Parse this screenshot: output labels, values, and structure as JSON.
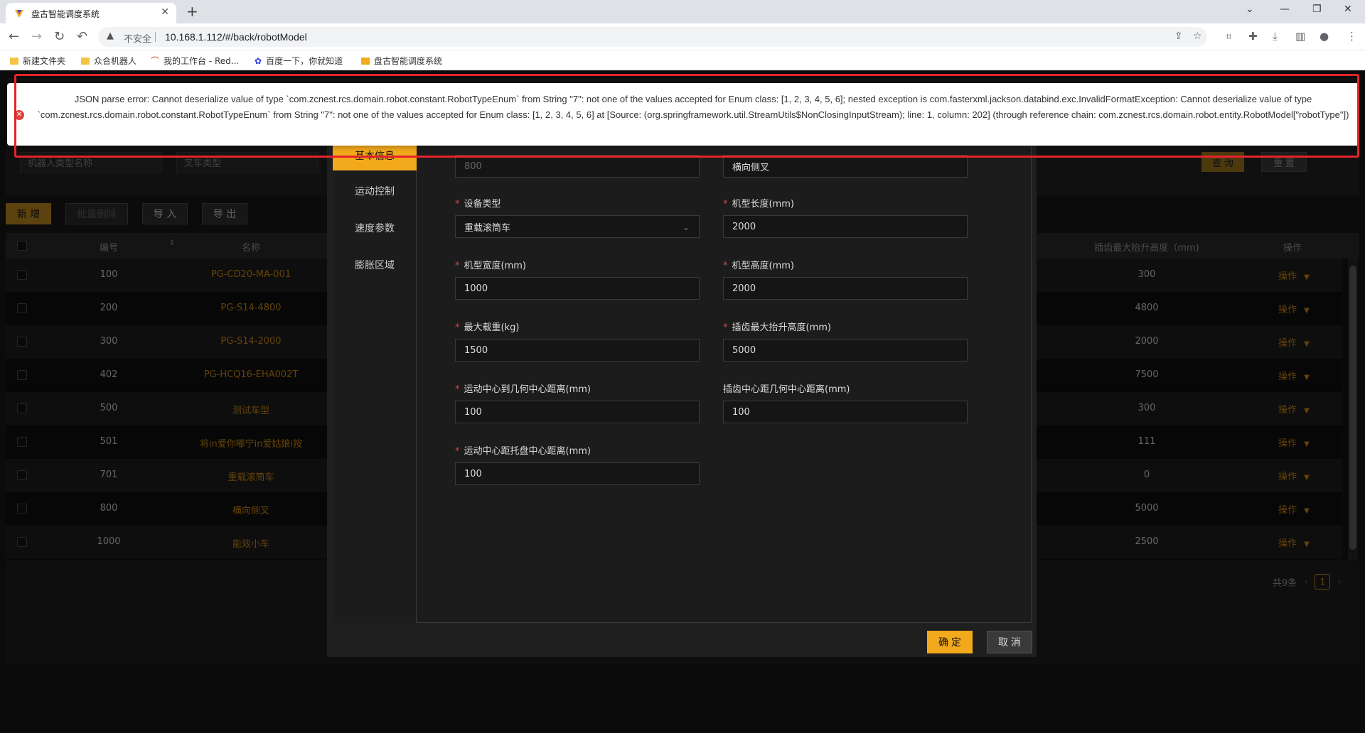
{
  "browser": {
    "tab_title": "盘古智能调度系统",
    "new_tab": "+",
    "insecure_label": "不安全",
    "url": "10.168.1.112/#/back/robotModel",
    "bookmarks": [
      {
        "label": "新建文件夹"
      },
      {
        "label": "众合机器人"
      },
      {
        "label": "我的工作台 - Red..."
      },
      {
        "label": "百度一下，你就知道"
      },
      {
        "label": "盘古智能调度系统"
      }
    ]
  },
  "search": {
    "type_name_placeholder": "机器人类型名称",
    "forklift_placeholder": "叉车类型",
    "query_label": "查 询",
    "reset_label": "重 置"
  },
  "actions": {
    "add": "新 增",
    "batch_delete": "批量删除",
    "import": "导 入",
    "export": "导 出"
  },
  "table": {
    "headers": {
      "id": "编号",
      "name": "名称",
      "lift": "插齿最大抬升高度（mm)",
      "op": "操作"
    },
    "rows": [
      {
        "id": "100",
        "name": "PG-CD20-MA-001",
        "lift": "300",
        "op": "操作"
      },
      {
        "id": "200",
        "name": "PG-S14-4800",
        "lift": "4800",
        "op": "操作"
      },
      {
        "id": "300",
        "name": "PG-S14-2000",
        "lift": "2000",
        "op": "操作"
      },
      {
        "id": "402",
        "name": "PG-HCQ16-EHA002T",
        "lift": "7500",
        "op": "操作"
      },
      {
        "id": "500",
        "name": "测试车型",
        "lift": "300",
        "op": "操作"
      },
      {
        "id": "501",
        "name": "将in爱你嘟宁in爱姑娘i按",
        "lift": "111",
        "op": "操作"
      },
      {
        "id": "701",
        "name": "重载滚筒车",
        "lift": "0",
        "op": "操作"
      },
      {
        "id": "800",
        "name": "横向侧叉",
        "lift": "5000",
        "op": "操作"
      },
      {
        "id": "1000",
        "name": "能效小车",
        "lift": "2500",
        "op": "操作"
      }
    ]
  },
  "pager": {
    "total": "共9条",
    "current": "1"
  },
  "modal": {
    "tabs": [
      "基本信息",
      "运动控制",
      "速度参数",
      "膨胀区域"
    ],
    "fields": {
      "code_value": "800",
      "name_value": "横向侧叉",
      "device_type_label": "设备类型",
      "device_type_value": "重载滚筒车",
      "length_label": "机型长度(mm)",
      "length_value": "2000",
      "width_label": "机型宽度(mm)",
      "width_value": "1000",
      "height_label": "机型高度(mm)",
      "height_value": "2000",
      "load_label": "最大载重(kg)",
      "load_value": "1500",
      "lift_label": "插齿最大抬升高度(mm)",
      "lift_value": "5000",
      "motion_geo_label": "运动中心到几何中心距离(mm)",
      "motion_geo_value": "100",
      "fork_geo_label": "插齿中心距几何中心距离(mm)",
      "fork_geo_value": "100",
      "motion_tray_label": "运动中心距托盘中心距离(mm)",
      "motion_tray_value": "100"
    },
    "confirm": "确 定",
    "cancel": "取 消"
  },
  "toast": {
    "message": "JSON parse error: Cannot deserialize value of type `com.zcnest.rcs.domain.robot.constant.RobotTypeEnum` from String \"7\": not one of the values accepted for Enum class: [1, 2, 3, 4, 5, 6]; nested exception is com.fasterxml.jackson.databind.exc.InvalidFormatException: Cannot deserialize value of type `com.zcnest.rcs.domain.robot.constant.RobotTypeEnum` from String \"7\": not one of the values accepted for Enum class: [1, 2, 3, 4, 5, 6] at [Source: (org.springframework.util.StreamUtils$NonClosingInputStream); line: 1, column: 202] (through reference chain: com.zcnest.rcs.domain.robot.entity.RobotModel[\"robotType\"])"
  },
  "colors": {
    "accent": "#f2a91c",
    "name_link": "#b87b12",
    "error": "#e3242b"
  }
}
